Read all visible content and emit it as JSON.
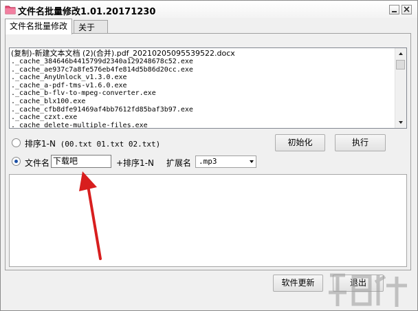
{
  "window": {
    "title": "文件名批量修改1.01.20171230"
  },
  "tabs": [
    {
      "label": "文件名批量修改",
      "active": true
    },
    {
      "label": "关于",
      "active": false
    }
  ],
  "file_list": {
    "items": [
      "(复制)-新建文本文档 (2)(合并).pdf_20210205095539522.docx",
      "._cache_384646b4415799d2340a129248678c52.exe",
      "._cache_ae937c7a8fe576eb4fe814d5b86d20cc.exe",
      "._cache_AnyUnlock_v1.3.0.exe",
      "._cache_a-pdf-tms-v1.6.0.exe",
      "._cache_b-flv-to-mpeg-converter.exe",
      "._cache_blx100.exe",
      "._cache_cfb8dfe91469af4bb7612fd85baf3b97.exe",
      "._cache_czxt.exe",
      "._cache_delete-multiple-files.exe"
    ]
  },
  "options": {
    "sort_label": "排序1-N",
    "sort_example": " (00.txt  01.txt 02.txt)",
    "filename_label": "文件名",
    "filename_value": "下载吧",
    "seq_label": "+排序1-N",
    "ext_label": "扩展名",
    "ext_value": ".mp3",
    "selected": "filename"
  },
  "buttons": {
    "init": "初始化",
    "execute": "执行",
    "update": "软件更新",
    "exit": "退出"
  },
  "colors": {
    "accent": "#1c50a6",
    "annotation_arrow": "#d81e1e",
    "app_icon": "#e8527a"
  }
}
